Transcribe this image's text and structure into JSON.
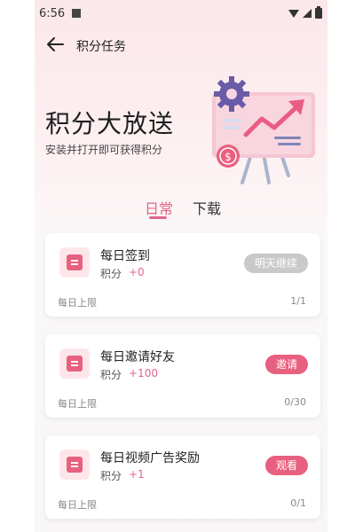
{
  "status_bar": {
    "time": "6:56"
  },
  "header": {
    "title": "积分任务"
  },
  "hero": {
    "title": "积分大放送",
    "subtitle": "安装并打开即可获得积分"
  },
  "tabs": [
    {
      "label": "日常",
      "active": true
    },
    {
      "label": "下载",
      "active": false
    }
  ],
  "tasks": [
    {
      "name": "每日签到",
      "points_label": "积分",
      "points_value": "+0",
      "button_label": "明天继续",
      "button_enabled": false,
      "limit_label": "每日上限",
      "limit_value": "1/1"
    },
    {
      "name": "每日邀请好友",
      "points_label": "积分",
      "points_value": "+100",
      "button_label": "邀请",
      "button_enabled": true,
      "limit_label": "每日上限",
      "limit_value": "0/30"
    },
    {
      "name": "每日视频广告奖励",
      "points_label": "积分",
      "points_value": "+1",
      "button_label": "观看",
      "button_enabled": true,
      "limit_label": "每日上限",
      "limit_value": "0/1"
    }
  ],
  "colors": {
    "accent": "#e0668a",
    "button_disabled": "#c9c9c9",
    "icon_bg": "#fde6ea"
  }
}
